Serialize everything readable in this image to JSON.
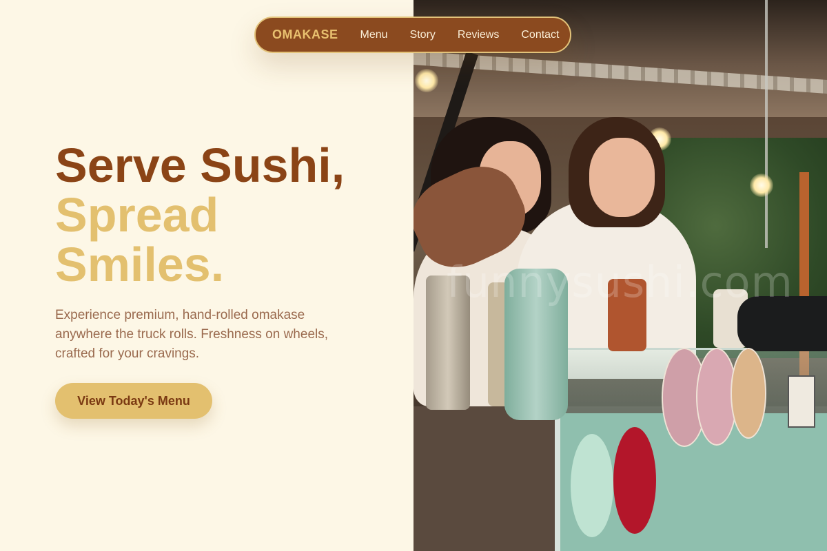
{
  "nav": {
    "brand": "OMAKASE",
    "links": [
      "Menu",
      "Story",
      "Reviews",
      "Contact"
    ]
  },
  "hero": {
    "title_line1": "Serve Sushi,",
    "title_line2": "Spread",
    "title_line3": "Smiles.",
    "subtitle": "Experience premium, hand-rolled omakase anywhere the truck rolls. Freshness on wheels, crafted for your cravings.",
    "cta_label": "View Today's Menu"
  },
  "photo": {
    "watermark": "funnysushi.com"
  },
  "colors": {
    "background": "#fdf7e6",
    "brown": "#8b4416",
    "gold": "#e3c06f",
    "nav_bg": "#8b4a1f",
    "body_text": "#9a6a4e"
  }
}
